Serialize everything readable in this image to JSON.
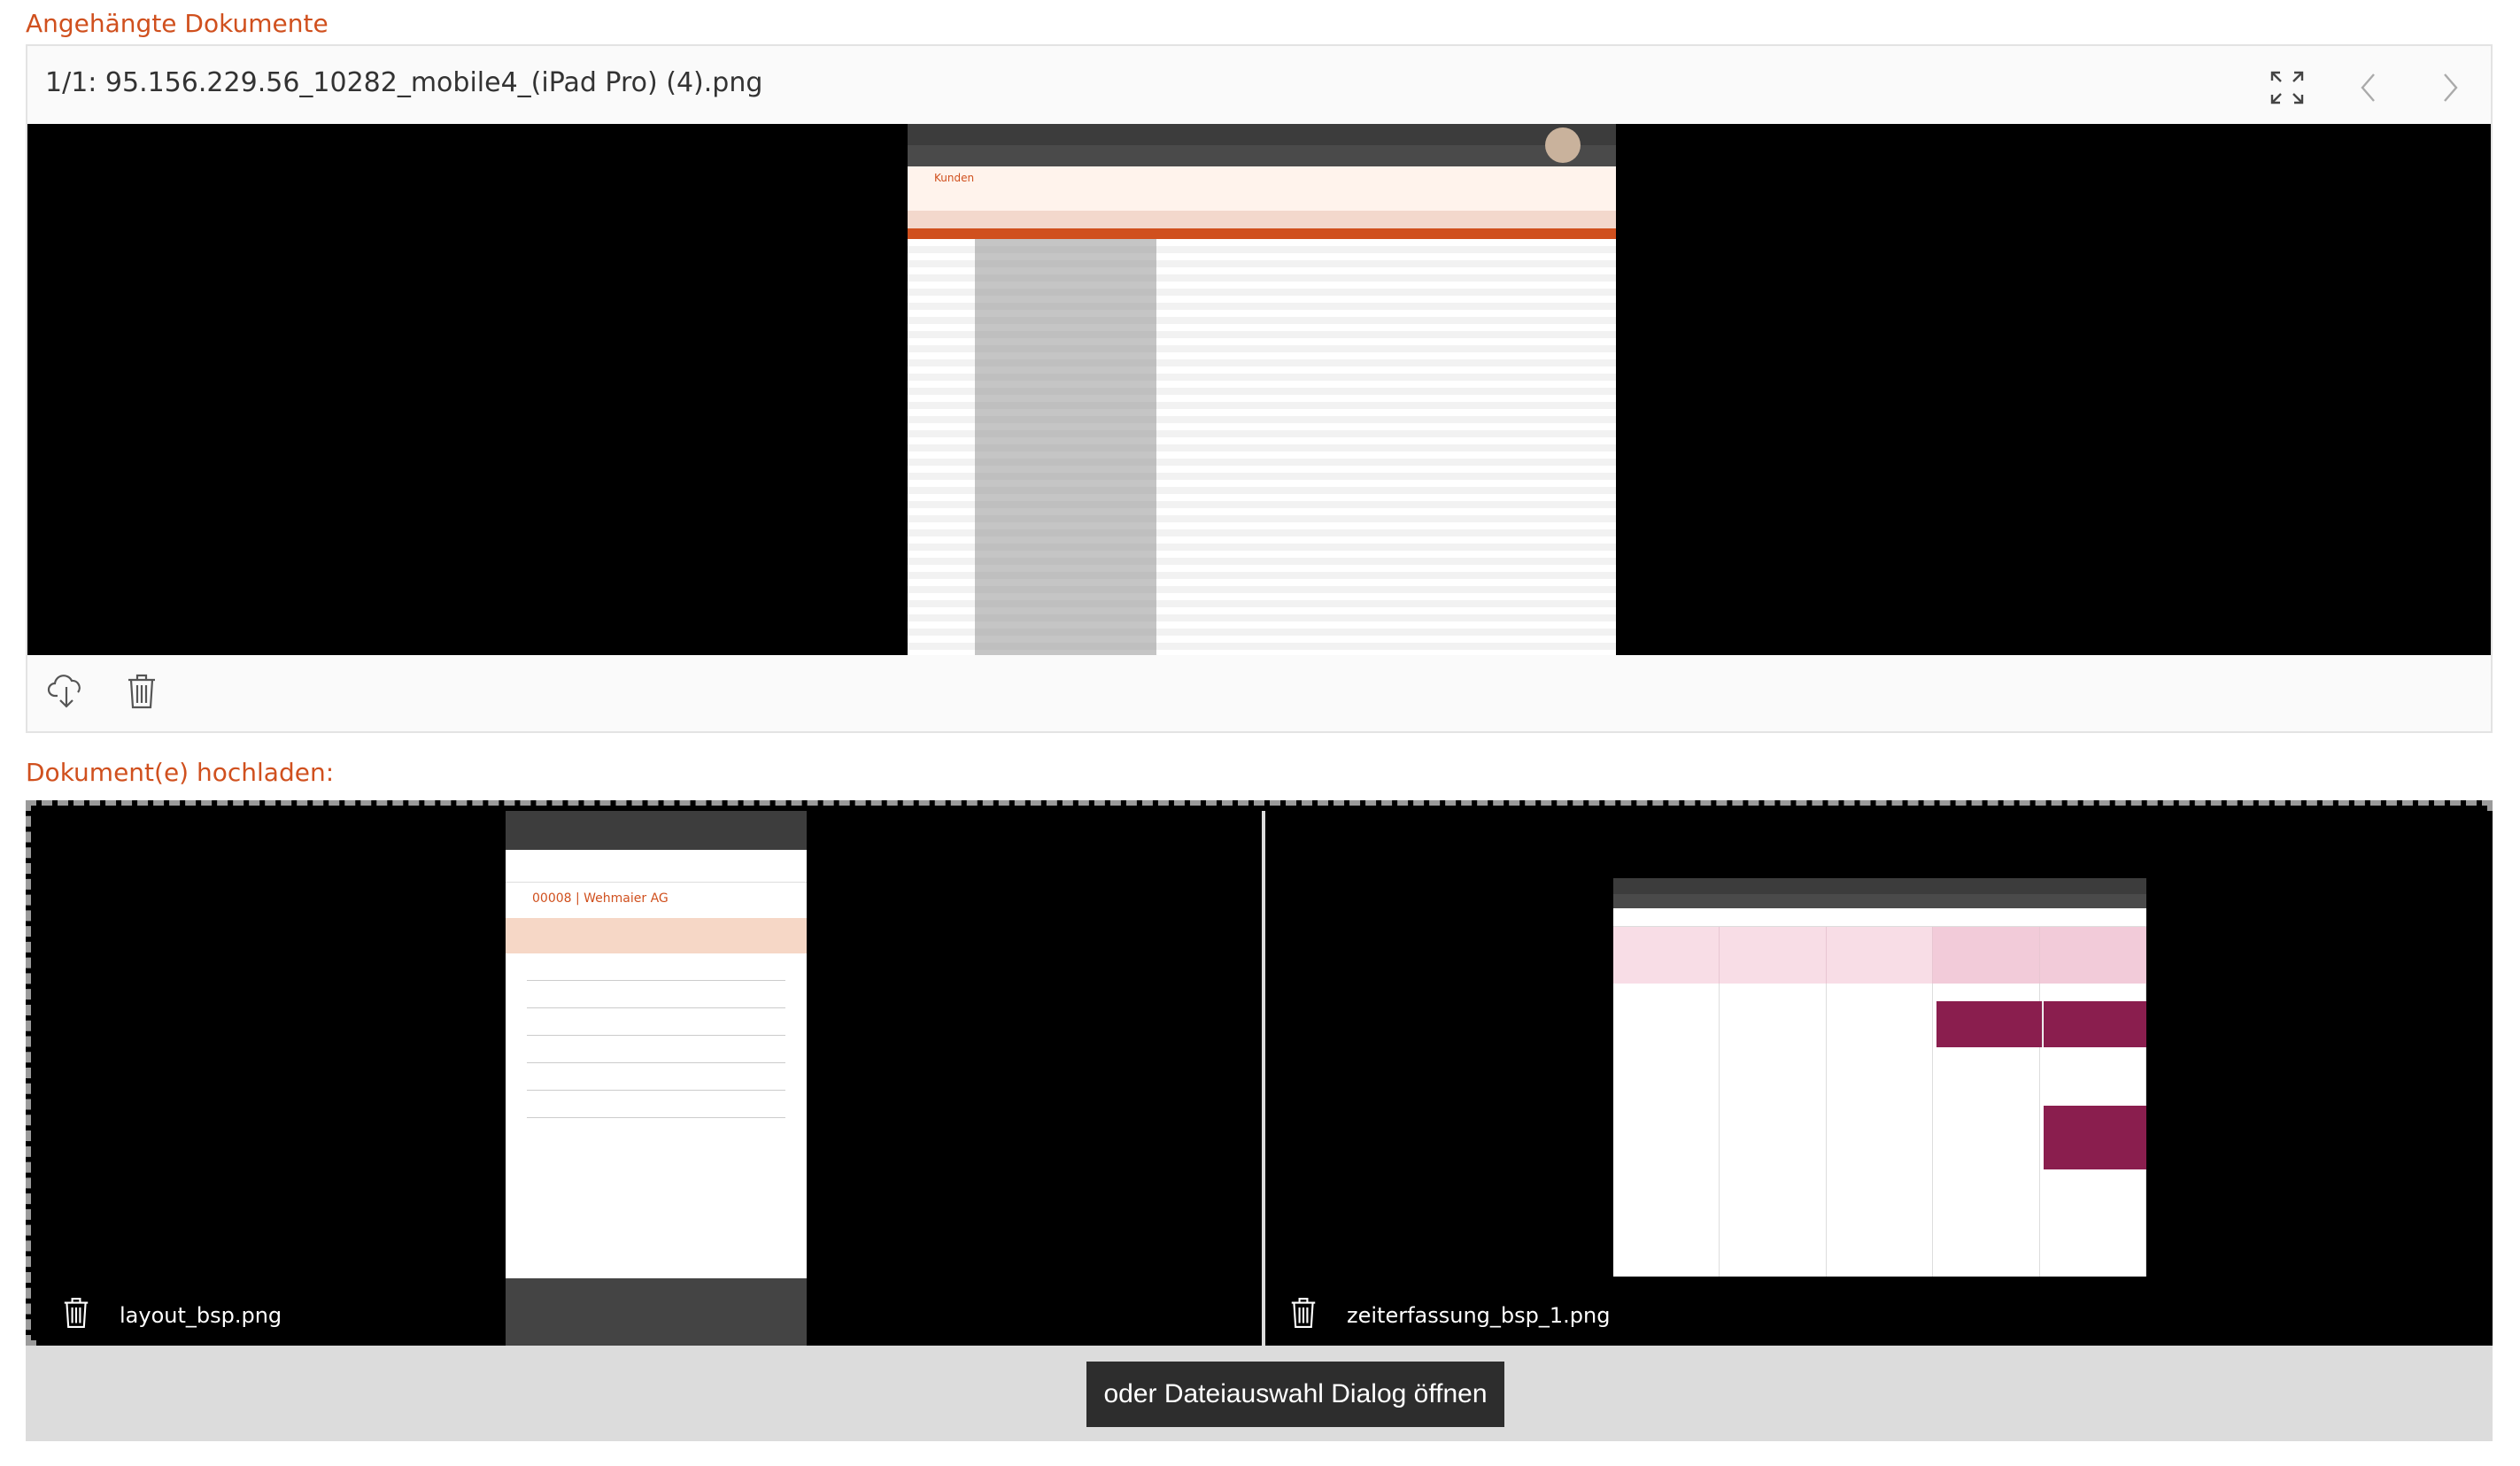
{
  "attached": {
    "title": "Angehängte Dokumente",
    "current_file": "1/1: 95.156.229.56_10282_mobile4_(iPad Pro) (4).png",
    "tools": {
      "fullscreen_icon": "expand-icon",
      "prev_icon": "chevron-left-icon",
      "next_icon": "chevron-right-icon"
    },
    "footer_icons": [
      "cloud-download-icon",
      "trash-icon"
    ],
    "preview": {
      "title": "Kunden"
    }
  },
  "upload": {
    "title": "Dokument(e) hochladen:",
    "files": [
      {
        "name": "layout_bsp.png",
        "mobile_title": "00008 | Wehmaier AG"
      },
      {
        "name": "zeiterfassung_bsp_1.png"
      }
    ],
    "open_dialog_label": "oder Dateiauswahl Dialog öffnen"
  },
  "colors": {
    "accent": "#d0501e",
    "panel_border": "#e3e3e3",
    "upload_bg": "#dcdcdc",
    "dialog_button": "#2d2d2d"
  }
}
